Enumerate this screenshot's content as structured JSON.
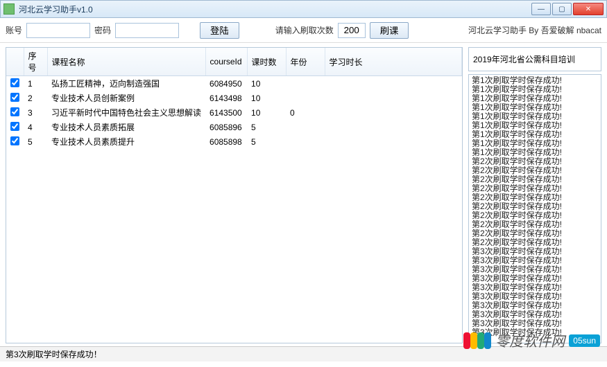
{
  "window": {
    "title": "河北云学习助手v1.0"
  },
  "toolbar": {
    "account_label": "账号",
    "password_label": "密码",
    "login_label": "登陆",
    "count_hint": "请输入刷取次数",
    "count_value": "200",
    "brush_label": "刷课",
    "credit": "河北云学习助手 By 吾爱破解 nbacat"
  },
  "table": {
    "headers": {
      "seq": "序号",
      "name": "课程名称",
      "courseId": "courseId",
      "lessons": "课时数",
      "year": "年份",
      "duration": "学习时长"
    },
    "rows": [
      {
        "seq": "1",
        "name": "弘扬工匠精神，迈向制造强国",
        "courseId": "6084950",
        "lessons": "10",
        "year": "",
        "duration": ""
      },
      {
        "seq": "2",
        "name": "专业技术人员创新案例",
        "courseId": "6143498",
        "lessons": "10",
        "year": "",
        "duration": ""
      },
      {
        "seq": "3",
        "name": "习近平新时代中国特色社会主义思想解读",
        "courseId": "6143500",
        "lessons": "10",
        "year": "0",
        "duration": ""
      },
      {
        "seq": "4",
        "name": "专业技术人员素质拓展",
        "courseId": "6085896",
        "lessons": "5",
        "year": "",
        "duration": ""
      },
      {
        "seq": "5",
        "name": "专业技术人员素质提升",
        "courseId": "6085898",
        "lessons": "5",
        "year": "",
        "duration": ""
      }
    ]
  },
  "groupbox": {
    "title": "2019年河北省公需科目培训"
  },
  "log_lines": [
    "第1次刷取学时保存成功!",
    "第1次刷取学时保存成功!",
    "第1次刷取学时保存成功!",
    "第1次刷取学时保存成功!",
    "第1次刷取学时保存成功!",
    "第1次刷取学时保存成功!",
    "第1次刷取学时保存成功!",
    "第1次刷取学时保存成功!",
    "第1次刷取学时保存成功!",
    "第2次刷取学时保存成功!",
    "第2次刷取学时保存成功!",
    "第2次刷取学时保存成功!",
    "第2次刷取学时保存成功!",
    "第2次刷取学时保存成功!",
    "第2次刷取学时保存成功!",
    "第2次刷取学时保存成功!",
    "第2次刷取学时保存成功!",
    "第2次刷取学时保存成功!",
    "第2次刷取学时保存成功!",
    "第3次刷取学时保存成功!",
    "第3次刷取学时保存成功!",
    "第3次刷取学时保存成功!",
    "第3次刷取学时保存成功!",
    "第3次刷取学时保存成功!",
    "第3次刷取学时保存成功!",
    "第3次刷取学时保存成功!",
    "第3次刷取学时保存成功!",
    "第3次刷取学时保存成功!",
    "第3次刷取学时保存成功!"
  ],
  "status": {
    "text": "第3次刷取学时保存成功！"
  },
  "watermark": {
    "text": "零度软件网",
    "tag": "05sun"
  }
}
